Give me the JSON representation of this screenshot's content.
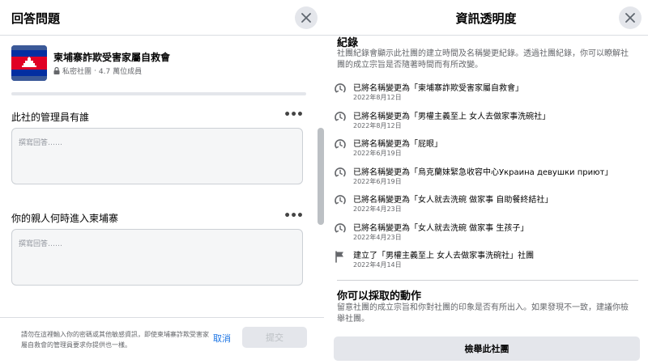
{
  "left_dialog": {
    "title": "回答問題",
    "group": {
      "name": "柬埔寨詐欺受害家屬自救會",
      "privacy": "私密社團",
      "members": "4.7 萬位成員"
    },
    "questions": [
      {
        "label": "此社的管理員有誰",
        "placeholder": "撰寫回答……",
        "more": "•••"
      },
      {
        "label": "你的親人何時進入柬埔寨",
        "placeholder": "撰寫回答……",
        "more": "•••"
      }
    ],
    "footer": {
      "note": "請勿在這裡輸入你的密碼或其他敏感資訊，即使柬埔寨詐欺受害家屬自救會的管理員要求你提供也一樣。",
      "cancel_label": "取消",
      "submit_label": "提交"
    }
  },
  "right_dialog": {
    "title": "資訊透明度",
    "history": {
      "title": "紀錄",
      "description": "社團紀錄會顯示此社團的建立時間及名稱變更紀錄。透過社團紀錄，你可以瞭解社團的成立宗旨是否隨著時間而有所改變。",
      "items": [
        {
          "icon": "rename-icon",
          "text": "已將名稱變更為「柬埔寨詐欺受害家屬自救會」",
          "date": "2022年8月12日"
        },
        {
          "icon": "rename-icon",
          "text": "已將名稱變更為「男權主義至上 女人去做家事洗碗社」",
          "date": "2022年8月12日"
        },
        {
          "icon": "rename-icon",
          "text": "已將名稱變更為「屁眼」",
          "date": "2022年6月19日"
        },
        {
          "icon": "rename-icon",
          "text": "已將名稱變更為「烏克蘭妹緊急收容中心Украина девушки приют」",
          "date": "2022年6月19日"
        },
        {
          "icon": "rename-icon",
          "text": "已將名稱變更為「女人就去洗碗 做家事 自助餐終結社」",
          "date": "2022年4月23日"
        },
        {
          "icon": "rename-icon",
          "text": "已將名稱變更為「女人就去洗碗 做家事 生孩子」",
          "date": "2022年4月23日"
        },
        {
          "icon": "flag-icon",
          "text": "建立了「男權主義至上 女人去做家事洗碗社」社團",
          "date": "2022年4月14日"
        }
      ]
    },
    "actions": {
      "title": "你可以採取的動作",
      "description": "留意社團的成立宗旨和你對社團的印象是否有所出入。如果發現不一致，建議你檢舉社團。",
      "report_label": "檢舉此社團"
    }
  },
  "colors": {
    "accent": "#1b74e4",
    "secondary_text": "#65676b",
    "button_bg": "#e4e6eb",
    "page_bg": "#f0f2f5"
  }
}
